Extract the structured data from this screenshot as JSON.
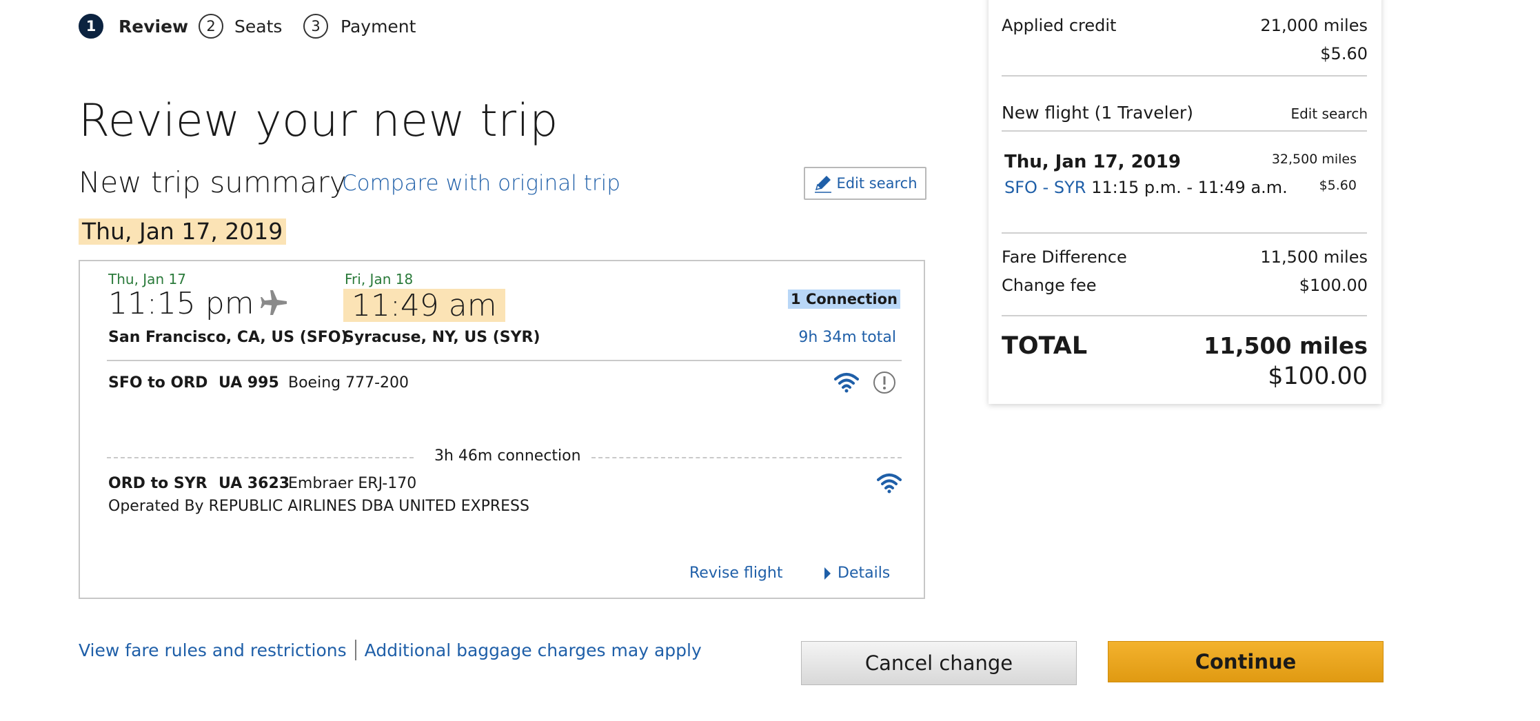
{
  "stepper": [
    {
      "num": "1",
      "label": "Review",
      "active": true
    },
    {
      "num": "2",
      "label": "Seats",
      "active": false
    },
    {
      "num": "3",
      "label": "Payment",
      "active": false
    }
  ],
  "page_title": "Review your new trip",
  "summary": {
    "title": "New trip summary",
    "compare_link": "Compare with original trip",
    "edit_search": "Edit search",
    "date": "Thu, Jan 17, 2019"
  },
  "flight": {
    "depart_date": "Thu, Jan 17",
    "depart_time": "11:15 pm",
    "arrive_date": "Fri, Jan 18",
    "arrive_time": "11:49 am",
    "origin": "San Francisco, CA, US (SFO)",
    "destination": "Syracuse, NY, US (SYR)",
    "connections": "1 Connection",
    "total_time": "9h 34m total",
    "segments": [
      {
        "route": "SFO to ORD",
        "flight": "UA 995",
        "aircraft": "Boeing 777-200",
        "operated_by": ""
      },
      {
        "route": "ORD to SYR",
        "flight": "UA 3623",
        "aircraft": "Embraer ERJ-170",
        "operated_by": "Operated By REPUBLIC AIRLINES DBA UNITED EXPRESS"
      }
    ],
    "layover": "3h 46m connection",
    "revise": "Revise flight",
    "details": "Details"
  },
  "panel": {
    "applied_credit_label": "Applied credit",
    "applied_credit_miles": "21,000 miles",
    "applied_credit_cash": "$5.60",
    "new_flight_label": "New flight (1 Traveler)",
    "edit_search": "Edit search",
    "flight_date": "Thu, Jan 17, 2019",
    "flight_route": "SFO - SYR",
    "flight_times": "11:15 p.m. - 11:49 a.m.",
    "flight_miles": "32,500 miles",
    "flight_cash": "$5.60",
    "fare_diff_label": "Fare Difference",
    "fare_diff_value": "11,500 miles",
    "change_fee_label": "Change fee",
    "change_fee_value": "$100.00",
    "total_label": "TOTAL",
    "total_miles": "11,500 miles",
    "total_cash": "$100.00"
  },
  "footer": {
    "fare_rules": "View fare rules and restrictions",
    "baggage": "Additional baggage charges may apply",
    "cancel": "Cancel change",
    "continue": "Continue"
  },
  "colors": {
    "link": "#1f5fa8",
    "highlight": "#fbe3b5",
    "selection": "#b9d7f7",
    "continue_button": "#f0a824",
    "green_date": "#2a7a3a",
    "step_active": "#0c2340"
  }
}
